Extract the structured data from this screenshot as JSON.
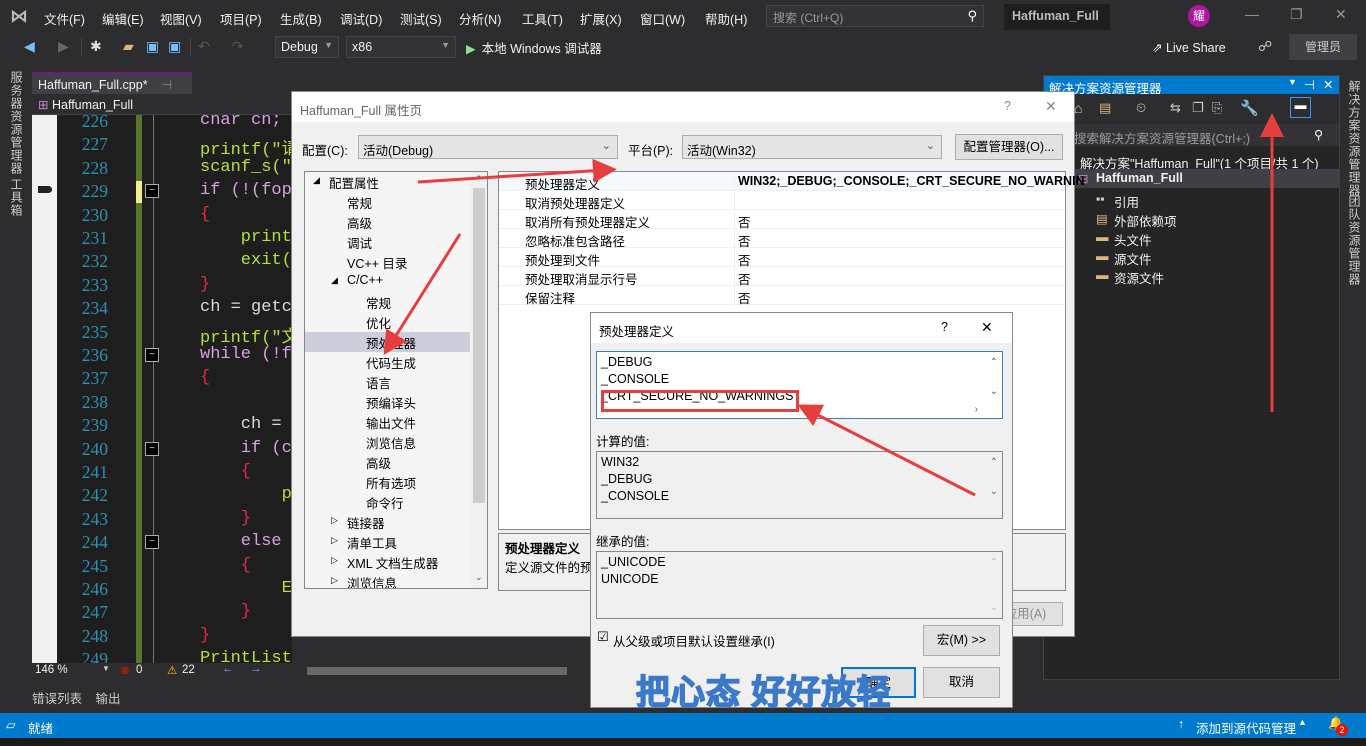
{
  "menu": {
    "items": [
      "文件(F)",
      "编辑(E)",
      "视图(V)",
      "项目(P)",
      "生成(B)",
      "调试(D)",
      "测试(S)",
      "分析(N)",
      "工具(T)",
      "扩展(X)",
      "窗口(W)",
      "帮助(H)"
    ],
    "search_placeholder": "搜索 (Ctrl+Q)",
    "solution_name": "Haffuman_Full",
    "avatar_text": "耀"
  },
  "toolbar": {
    "config": "Debug",
    "platform": "x86",
    "run_label": "本地 Windows 调试器",
    "live_share": "Live Share",
    "admin": "管理员"
  },
  "left_strip": {
    "tabs": [
      "服务器资源管理器",
      "工具箱"
    ]
  },
  "editor": {
    "tab_label": "Haffuman_Full.cpp*",
    "nav_scope": "Haffuman_Full",
    "lines": [
      {
        "n": "226",
        "text": "char ch;"
      },
      {
        "n": "227",
        "text": "printf(\"请"
      },
      {
        "n": "228",
        "text": "scanf_s(\"%"
      },
      {
        "n": "229",
        "text": "if (!(fope"
      },
      {
        "n": "230",
        "text": "{"
      },
      {
        "n": "231",
        "text": "    printf"
      },
      {
        "n": "232",
        "text": "    exit(0"
      },
      {
        "n": "233",
        "text": "}"
      },
      {
        "n": "234",
        "text": "ch = getch"
      },
      {
        "n": "235",
        "text": "printf(\"文"
      },
      {
        "n": "236",
        "text": "while (!fe"
      },
      {
        "n": "237",
        "text": "{"
      },
      {
        "n": "238",
        "text": ""
      },
      {
        "n": "239",
        "text": "    ch = f"
      },
      {
        "n": "240",
        "text": "    if (ch"
      },
      {
        "n": "241",
        "text": "    {"
      },
      {
        "n": "242",
        "text": "        pr"
      },
      {
        "n": "243",
        "text": "    }"
      },
      {
        "n": "244",
        "text": "    else"
      },
      {
        "n": "245",
        "text": "    {"
      },
      {
        "n": "246",
        "text": "        En"
      },
      {
        "n": "247",
        "text": "    }"
      },
      {
        "n": "248",
        "text": "}"
      },
      {
        "n": "249",
        "text": "PrintList(L);"
      }
    ],
    "zoom": "146 %",
    "errors": "0",
    "warnings": "22"
  },
  "bottom_tabs": [
    "错误列表",
    "输出"
  ],
  "status": {
    "ready": "就绪",
    "source_control": "添加到源代码管理",
    "notifications": "2"
  },
  "solution_explorer": {
    "title": "解决方案资源管理器",
    "search_placeholder": "搜索解决方案资源管理器(Ctrl+;)",
    "solution_label": "解决方案\"Haffuman_Full\"(1 个项目/共 1 个)",
    "project": "Haffuman_Full",
    "items": [
      "引用",
      "外部依赖项",
      "头文件",
      "源文件",
      "资源文件"
    ]
  },
  "right_strip": {
    "tabs": [
      "解决方案资源管理器",
      "团队资源管理器"
    ]
  },
  "property_dialog": {
    "title": "Haffuman_Full 属性页",
    "config_label": "配置(C):",
    "config_value": "活动(Debug)",
    "platform_label": "平台(P):",
    "platform_value": "活动(Win32)",
    "config_manager": "配置管理器(O)...",
    "tree": [
      {
        "label": "配置属性",
        "level": 0,
        "expander": "◢"
      },
      {
        "label": "常规",
        "level": 1
      },
      {
        "label": "高级",
        "level": 1
      },
      {
        "label": "调试",
        "level": 1
      },
      {
        "label": "VC++ 目录",
        "level": 1
      },
      {
        "label": "C/C++",
        "level": 1,
        "expander": "◢"
      },
      {
        "label": "常规",
        "level": 2
      },
      {
        "label": "优化",
        "level": 2
      },
      {
        "label": "预处理器",
        "level": 2,
        "selected": true
      },
      {
        "label": "代码生成",
        "level": 2
      },
      {
        "label": "语言",
        "level": 2
      },
      {
        "label": "预编译头",
        "level": 2
      },
      {
        "label": "输出文件",
        "level": 2
      },
      {
        "label": "浏览信息",
        "level": 2
      },
      {
        "label": "高级",
        "level": 2
      },
      {
        "label": "所有选项",
        "level": 2
      },
      {
        "label": "命令行",
        "level": 2
      },
      {
        "label": "链接器",
        "level": 1,
        "expander": "▷"
      },
      {
        "label": "清单工具",
        "level": 1,
        "expander": "▷"
      },
      {
        "label": "XML 文档生成器",
        "level": 1,
        "expander": "▷"
      },
      {
        "label": "浏览信息",
        "level": 1,
        "expander": "▷"
      }
    ],
    "properties": [
      {
        "key": "预处理器定义",
        "value": "WIN32;_DEBUG;_CONSOLE;_CRT_SECURE_NO_WARNIN"
      },
      {
        "key": "取消预处理器定义",
        "value": ""
      },
      {
        "key": "取消所有预处理器定义",
        "value": "否"
      },
      {
        "key": "忽略标准包含路径",
        "value": "否"
      },
      {
        "key": "预处理到文件",
        "value": "否"
      },
      {
        "key": "预处理取消显示行号",
        "value": "否"
      },
      {
        "key": "保留注释",
        "value": "否"
      }
    ],
    "desc_title": "预处理器定义",
    "desc_text": "定义源文件的预处",
    "apply": "应用(A)"
  },
  "preprocessor_dialog": {
    "title": "预处理器定义",
    "help": "?",
    "edit_lines": [
      "_DEBUG",
      "_CONSOLE",
      "_CRT_SECURE_NO_WARNINGS"
    ],
    "computed_label": "计算的值:",
    "computed_lines": [
      "WIN32",
      "_DEBUG",
      "_CONSOLE"
    ],
    "inherited_label": "继承的值:",
    "inherited_lines": [
      "_UNICODE",
      "UNICODE"
    ],
    "inherit_checkbox": "从父级或项目默认设置继承(I)",
    "inherit_checked": true,
    "macro_button": "宏(M) >>",
    "ok_button": "确定",
    "cancel_button": "取消",
    "watermark": "把心态 好好放轻"
  },
  "colors": {
    "accent": "#007acc",
    "annotation_red": "#e63e3e",
    "avatar": "#b0169f"
  }
}
